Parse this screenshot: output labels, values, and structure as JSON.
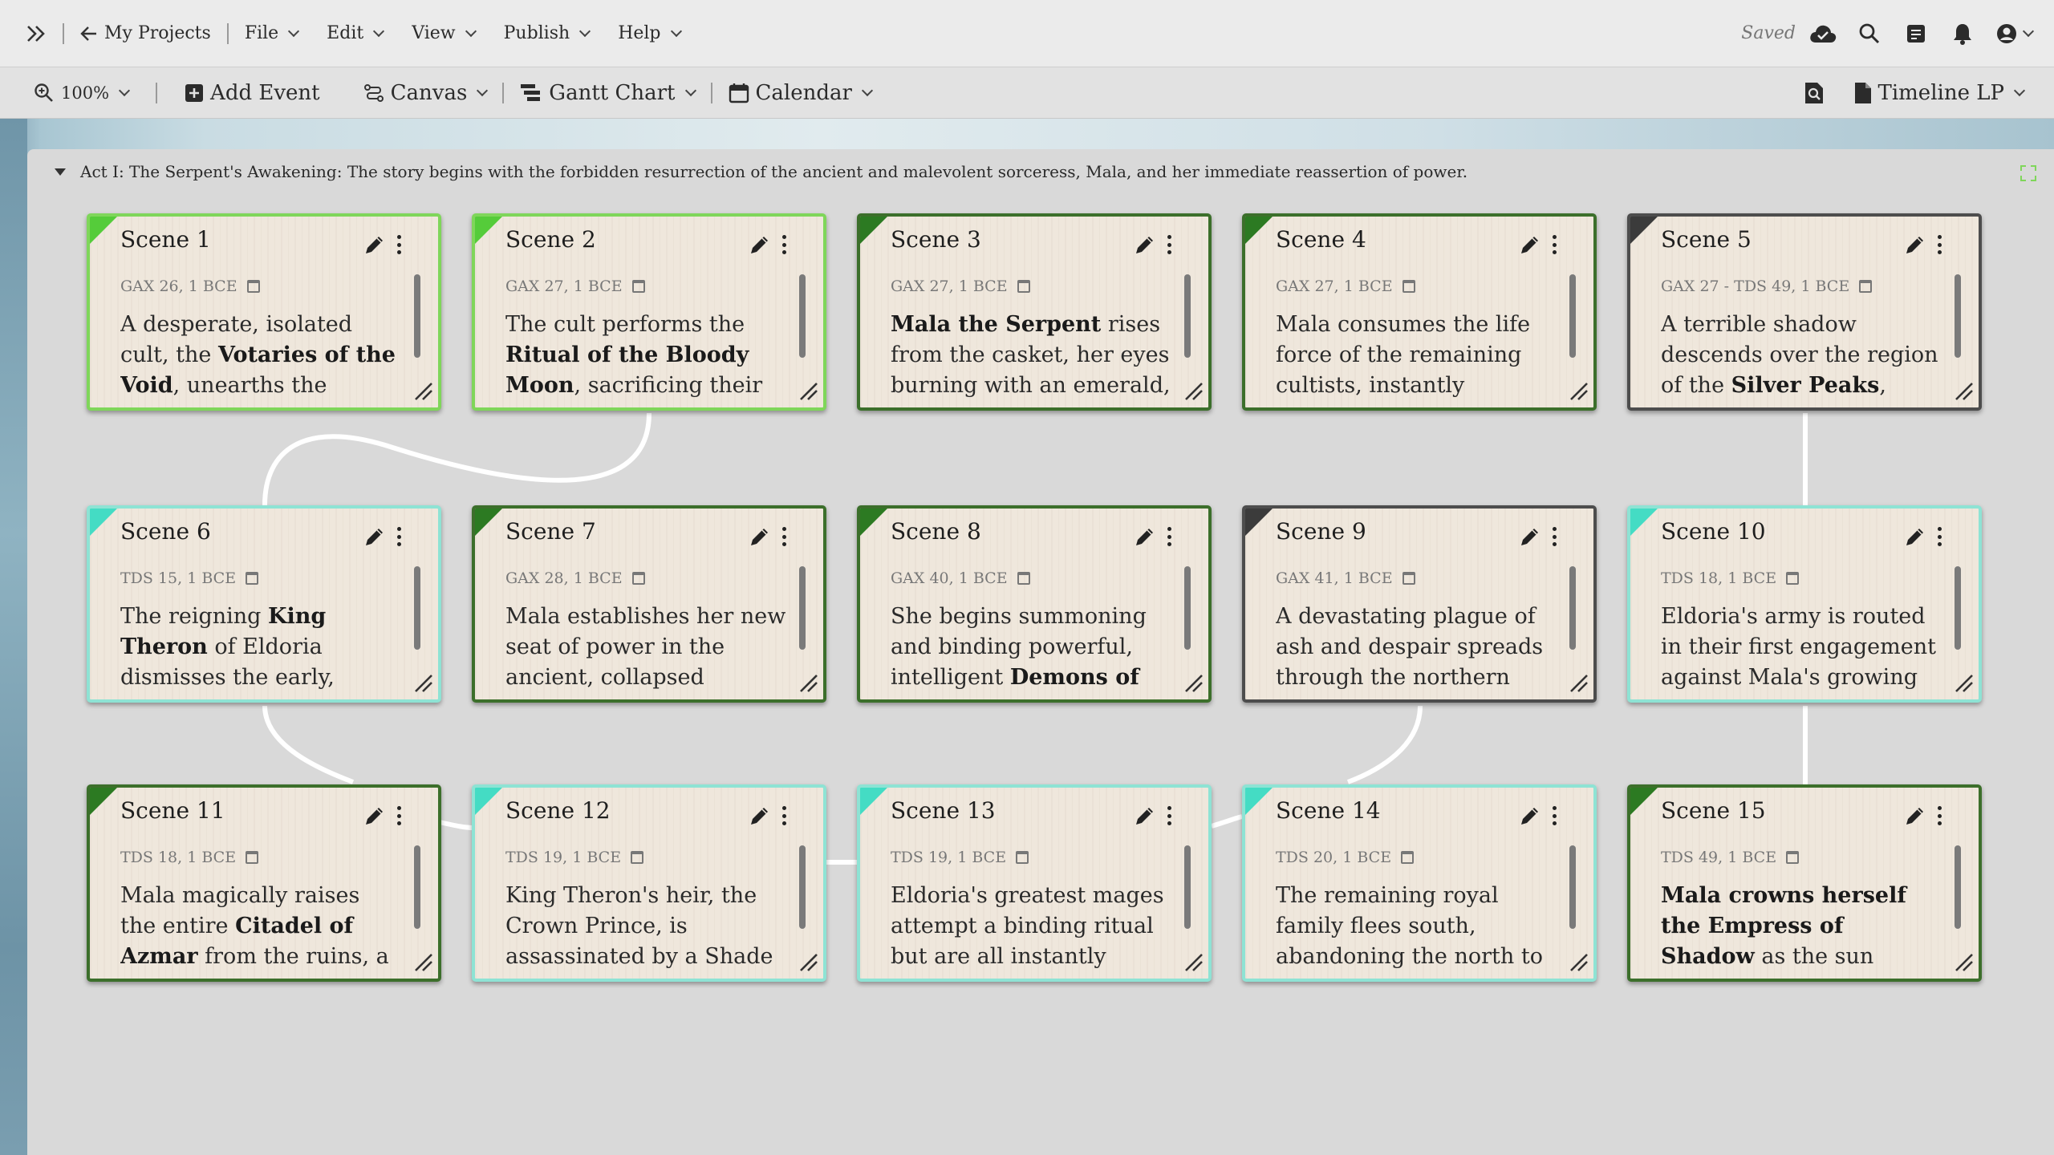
{
  "topbar": {
    "back_label": "My Projects",
    "menus": [
      "File",
      "Edit",
      "View",
      "Publish",
      "Help"
    ],
    "status": "Saved"
  },
  "toolbar": {
    "zoom": "100%",
    "add_event": "Add Event",
    "canvas": "Canvas",
    "gantt": "Gantt Chart",
    "calendar": "Calendar",
    "timeline": "Timeline LP"
  },
  "act": {
    "title": "Act I: The Serpent's Awakening: The story begins with the forbidden resurrection of the ancient and malevolent sorceress, Mala, and her immediate reassertion of power."
  },
  "colors": {
    "light_green": "#7fd65a",
    "dark_green": "#3c6f2b",
    "teal": "#8ee3d4",
    "dark": "#4d4d4d",
    "connector": "#ffffff"
  },
  "scenes": [
    {
      "title": "Scene 1",
      "date": "GAX 26, 1 BCE",
      "desc": "A desperate, isolated cult, the <b>Votaries of the Void</b>, unearths the Obsidian",
      "style": "green"
    },
    {
      "title": "Scene 2",
      "date": "GAX 27, 1 BCE",
      "desc": "The cult performs the <b>Ritual of the Bloody Moon</b>, sacrificing their own high",
      "style": "green"
    },
    {
      "title": "Scene 3",
      "date": "GAX 27, 1 BCE",
      "desc": "<b>Mala the Serpent</b> rises from the casket, her eyes burning with an emerald,",
      "style": "dgreen"
    },
    {
      "title": "Scene 4",
      "date": "GAX 27, 1 BCE",
      "desc": "Mala consumes the life force of the remaining cultists, instantly",
      "style": "dgreen"
    },
    {
      "title": "Scene 5",
      "date": "GAX 27 - TDS 49, 1 BCE",
      "desc": "A terrible shadow descends over the region of the <b>Silver Peaks</b>,",
      "style": "dark"
    },
    {
      "title": "Scene 6",
      "date": "TDS 15, 1 BCE",
      "desc": "The reigning <b>King Theron</b> of Eldoria dismisses the early, vague reports of",
      "style": "teal"
    },
    {
      "title": "Scene 7",
      "date": "GAX 28, 1 BCE",
      "desc": "Mala establishes her new seat of power in the ancient, collapsed volcano",
      "style": "dgreen"
    },
    {
      "title": "Scene 8",
      "date": "GAX 40, 1 BCE",
      "desc": "She begins summoning and binding powerful, intelligent <b>Demons of the</b>",
      "style": "dgreen"
    },
    {
      "title": "Scene 9",
      "date": "GAX 41, 1 BCE",
      "desc": "A devastating plague of ash and despair spreads through the northern",
      "style": "dark"
    },
    {
      "title": "Scene 10",
      "date": "TDS 18, 1 BCE",
      "desc": "Eldoria's army is routed in their first engagement against Mala's growing",
      "style": "teal"
    },
    {
      "title": "Scene 11",
      "date": "TDS 18, 1 BCE",
      "desc": "Mala magically raises the entire <b>Citadel of Azmar</b> from the ruins, a",
      "style": "dgreen"
    },
    {
      "title": "Scene 12",
      "date": "TDS 19, 1 BCE",
      "desc": "King Theron's heir, the Crown Prince, is assassinated by a Shade",
      "style": "teal"
    },
    {
      "title": "Scene 13",
      "date": "TDS 19, 1 BCE",
      "desc": "Eldoria's greatest mages attempt a binding ritual but are all instantly",
      "style": "teal"
    },
    {
      "title": "Scene 14",
      "date": "TDS 20, 1 BCE",
      "desc": "The remaining royal family flees south, abandoning the north to",
      "style": "teal"
    },
    {
      "title": "Scene 15",
      "date": "TDS 49, 1 BCE",
      "desc": "<b>Mala crowns herself the Empress of Shadow</b> as the sun disappears from",
      "style": "dgreen"
    }
  ]
}
